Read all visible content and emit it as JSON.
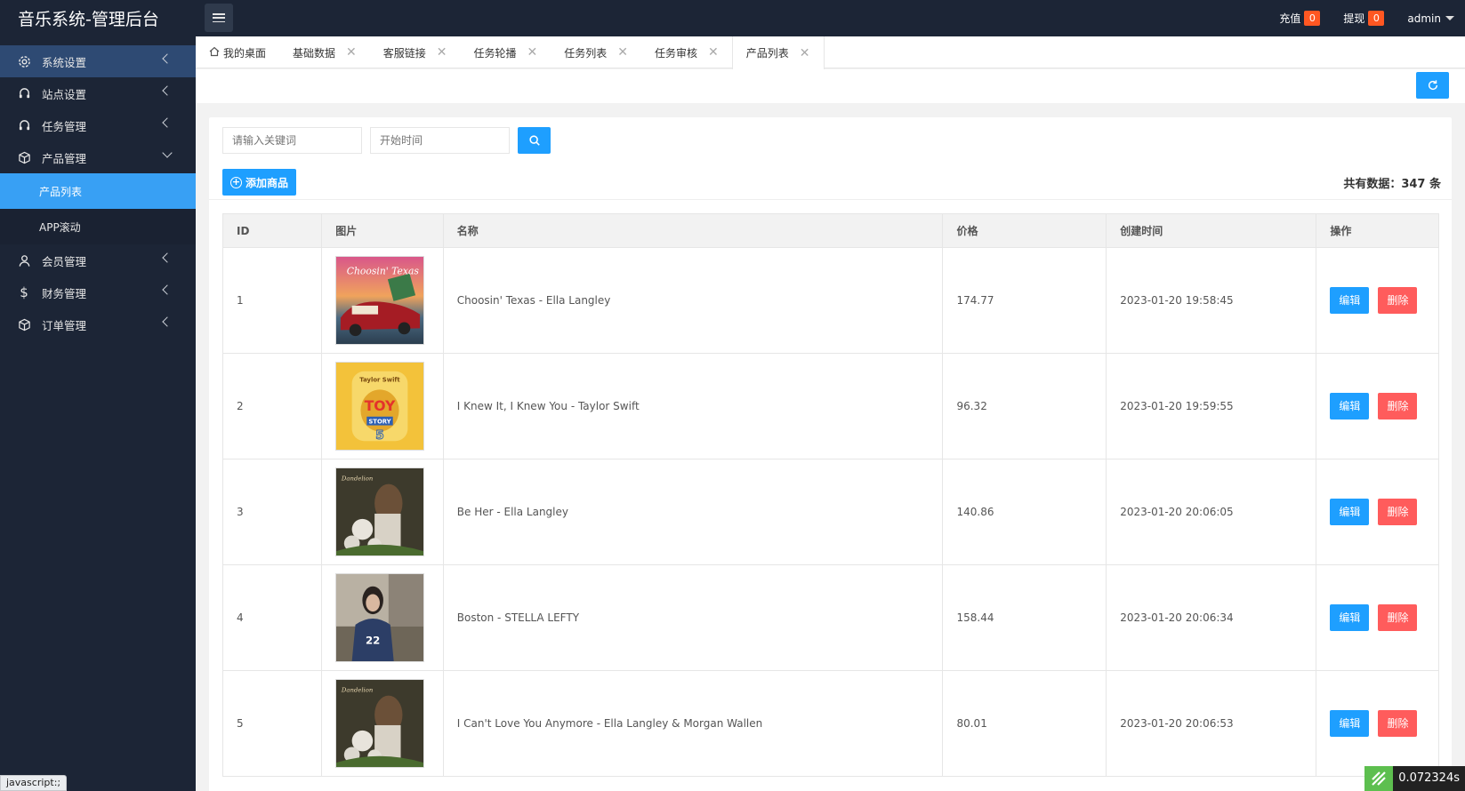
{
  "header": {
    "brand": "音乐系统-管理后台",
    "recharge_label": "充值",
    "recharge_count": "0",
    "withdraw_label": "提现",
    "withdraw_count": "0",
    "user": "admin"
  },
  "sidebar": {
    "items": [
      {
        "label": "系统设置",
        "icon": "gear-icon"
      },
      {
        "label": "站点设置",
        "icon": "headset-icon"
      },
      {
        "label": "任务管理",
        "icon": "headset-icon"
      },
      {
        "label": "产品管理",
        "icon": "box-icon"
      },
      {
        "label": "产品列表"
      },
      {
        "label": "APP滚动"
      },
      {
        "label": "会员管理",
        "icon": "user-icon"
      },
      {
        "label": "财务管理",
        "icon": "dollar-icon"
      },
      {
        "label": "订单管理",
        "icon": "box-icon"
      }
    ]
  },
  "tabs": [
    {
      "label": "我的桌面"
    },
    {
      "label": "基础数据"
    },
    {
      "label": "客服链接"
    },
    {
      "label": "任务轮播"
    },
    {
      "label": "任务列表"
    },
    {
      "label": "任务审核"
    },
    {
      "label": "产品列表"
    }
  ],
  "toolbar": {
    "keyword_placeholder": "请输入关键词",
    "start_time_placeholder": "开始时间",
    "add_label": "添加商品",
    "total_label": "共有数据：347 条"
  },
  "table": {
    "headers": [
      "ID",
      "图片",
      "名称",
      "价格",
      "创建时间",
      "操作"
    ],
    "edit_label": "编辑",
    "delete_label": "删除",
    "rows": [
      {
        "id": "1",
        "name": "Choosin' Texas - Ella Langley",
        "price": "174.77",
        "created": "2023-01-20 19:58:45"
      },
      {
        "id": "2",
        "name": "I Knew It, I Knew You - Taylor Swift",
        "price": "96.32",
        "created": "2023-01-20 19:59:55"
      },
      {
        "id": "3",
        "name": "Be Her - Ella Langley",
        "price": "140.86",
        "created": "2023-01-20 20:06:05"
      },
      {
        "id": "4",
        "name": "Boston - STELLA LEFTY",
        "price": "158.44",
        "created": "2023-01-20 20:06:34"
      },
      {
        "id": "5",
        "name": "I Can't Love You Anymore - Ella Langley & Morgan Wallen",
        "price": "80.01",
        "created": "2023-01-20 20:06:53"
      }
    ]
  },
  "status": {
    "link_tip": "javascript:;",
    "timer": "0.072324s"
  },
  "colors": {
    "sidebar_bg": "#1c2536",
    "accent": "#1e9fff",
    "danger": "#ff5c5c",
    "badge": "#ff5722"
  }
}
